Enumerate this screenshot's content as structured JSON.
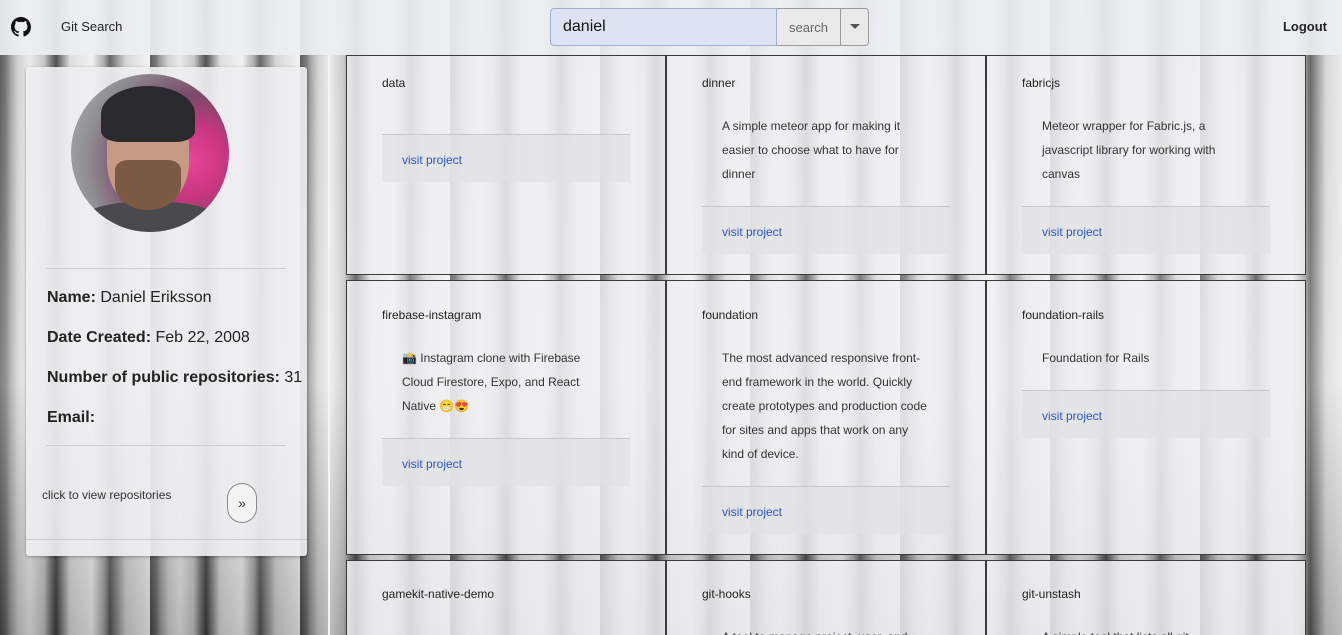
{
  "header": {
    "brand": "Git Search",
    "search_value": "daniel",
    "search_button": "search",
    "logout": "Logout"
  },
  "profile": {
    "name_label": "Name:",
    "name_value": "Daniel Eriksson",
    "date_label": "Date Created:",
    "date_value": "Feb 22, 2008",
    "repos_label": "Number of public repositories:",
    "repos_value": "31",
    "email_label": "Email:",
    "email_value": "",
    "view_repos_text": "click to view repositories",
    "view_repos_icon": "double-chevron-right-icon"
  },
  "repos": [
    {
      "title": "data",
      "description": "",
      "link": "visit project"
    },
    {
      "title": "dinner",
      "description": "A simple meteor app for making it easier to choose what to have for dinner",
      "link": "visit project"
    },
    {
      "title": "fabricjs",
      "description": "Meteor wrapper for Fabric.js, a javascript library for working with canvas",
      "link": "visit project"
    },
    {
      "title": "firebase-instagram",
      "description": "📸 Instagram clone with Firebase Cloud Firestore, Expo, and React Native 😁😍",
      "link": "visit project"
    },
    {
      "title": "foundation",
      "description": "The most advanced responsive front-end framework in the world. Quickly create prototypes and production code for sites and apps that work on any kind of device.",
      "link": "visit project"
    },
    {
      "title": "foundation-rails",
      "description": "Foundation for Rails",
      "link": "visit project"
    },
    {
      "title": "gamekit-native-demo",
      "description": "",
      "link": ""
    },
    {
      "title": "git-hooks",
      "description": "A tool to manage project, user, and",
      "link": ""
    },
    {
      "title": "git-unstash",
      "description": "A simple tool that lists all git",
      "link": ""
    }
  ]
}
